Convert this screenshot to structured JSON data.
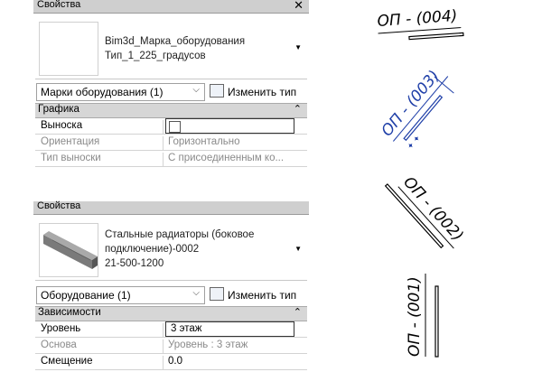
{
  "panel1": {
    "title": "Свойства",
    "type_name_line1": "Bim3d_Марка_оборудования",
    "type_name_line2": "Тип_1_225_градусов",
    "selector": "Марки оборудования (1)",
    "edit_type": "Изменить тип",
    "group": "Графика",
    "rows": [
      {
        "label": "Выноска",
        "value": ""
      },
      {
        "label": "Ориентация",
        "value": "Горизонтально"
      },
      {
        "label": "Тип выноски",
        "value": "С присоединенным ко..."
      }
    ]
  },
  "panel2": {
    "title": "Свойства",
    "type_name_line1": "Стальные радиаторы (боковое",
    "type_name_line2": "подключение)-0002",
    "type_name_line3": "21-500-1200",
    "selector": "Оборудование (1)",
    "edit_type": "Изменить тип",
    "group": "Зависимости",
    "rows": [
      {
        "label": "Уровень",
        "value": "3 этаж"
      },
      {
        "label": "Основа",
        "value": "Уровень : 3 этаж"
      },
      {
        "label": "Смещение",
        "value": "0.0"
      }
    ]
  },
  "tags": [
    {
      "text": "ОП - (004)",
      "color": "#000000"
    },
    {
      "text": "ОП - (003)",
      "color": "#1f3fa8"
    },
    {
      "text": "ОП - (002)",
      "color": "#000000"
    },
    {
      "text": "ОП - (001)",
      "color": "#000000"
    }
  ]
}
